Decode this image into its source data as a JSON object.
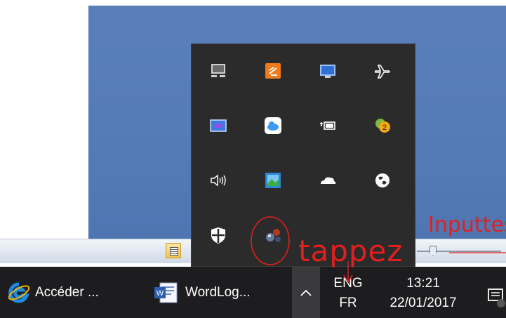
{
  "taskbar": {
    "ie_label": "Accéder ...",
    "word_label": "WordLog...",
    "lang_top": "ENG",
    "lang_bottom": "FR",
    "time": "13:21",
    "date": "22/01/2017"
  },
  "tray_icons": [
    "network-icon",
    "dropbox-icon",
    "display-icon",
    "airplane-icon",
    "monitor-icon",
    "icloud-icon",
    "battery-icon",
    "badge-app-icon",
    "volume-icon",
    "photo-app-icon",
    "onedrive-icon",
    "earth-icon",
    "defender-shield-icon",
    "molecule-app-icon"
  ],
  "annotations": {
    "tap_text": "tappez",
    "handwriting_right": "Inputtes"
  },
  "colors": {
    "desktop": "#5a7fb8",
    "tray_bg": "#2b2b2b",
    "taskbar_bg": "#1d1d1f",
    "annotation_red": "#e0201e",
    "accent_blue": "#0a6cd6"
  }
}
